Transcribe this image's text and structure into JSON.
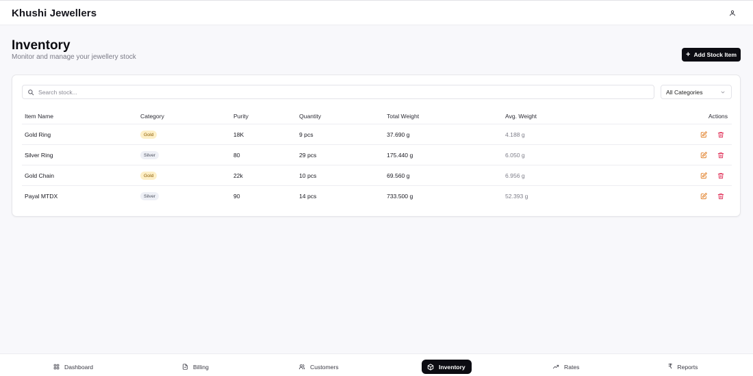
{
  "app": {
    "brand": "Khushi Jewellers"
  },
  "header": {
    "title": "Inventory",
    "subtitle": "Monitor and manage your jewellery stock",
    "add_button": "Add Stock Item"
  },
  "filters": {
    "search_placeholder": "Search stock...",
    "category_selected": "All Categories"
  },
  "table": {
    "columns": [
      "Item Name",
      "Category",
      "Purity",
      "Quantity",
      "Total Weight",
      "Avg. Weight",
      "Actions"
    ],
    "rows": [
      {
        "name": "Gold Ring",
        "category": "Gold",
        "purity": "18K",
        "quantity": "9 pcs",
        "total_weight": "37.690 g",
        "avg_weight": "4.188 g"
      },
      {
        "name": "Silver Ring",
        "category": "Silver",
        "purity": "80",
        "quantity": "29 pcs",
        "total_weight": "175.440 g",
        "avg_weight": "6.050 g"
      },
      {
        "name": "Gold Chain",
        "category": "Gold",
        "purity": "22k",
        "quantity": "10 pcs",
        "total_weight": "69.560 g",
        "avg_weight": "6.956 g"
      },
      {
        "name": "Payal MTDX",
        "category": "Silver",
        "purity": "90",
        "quantity": "14 pcs",
        "total_weight": "733.500 g",
        "avg_weight": "52.393 g"
      }
    ]
  },
  "nav": {
    "items": [
      {
        "label": "Dashboard",
        "icon": "grid-icon"
      },
      {
        "label": "Billing",
        "icon": "file-icon"
      },
      {
        "label": "Customers",
        "icon": "users-icon"
      },
      {
        "label": "Inventory",
        "icon": "package-icon",
        "active": true
      },
      {
        "label": "Rates",
        "icon": "trending-up-icon"
      },
      {
        "label": "Reports",
        "icon": "rupee-icon"
      }
    ]
  },
  "colors": {
    "primary": "#0c0c12",
    "background": "#f8f8fb",
    "gold_badge_bg": "#fdefc7",
    "gold_badge_text": "#8a5a00",
    "silver_badge_bg": "#eef0f6",
    "edit_icon": "#e07a1f",
    "delete_icon": "#e0335a"
  }
}
